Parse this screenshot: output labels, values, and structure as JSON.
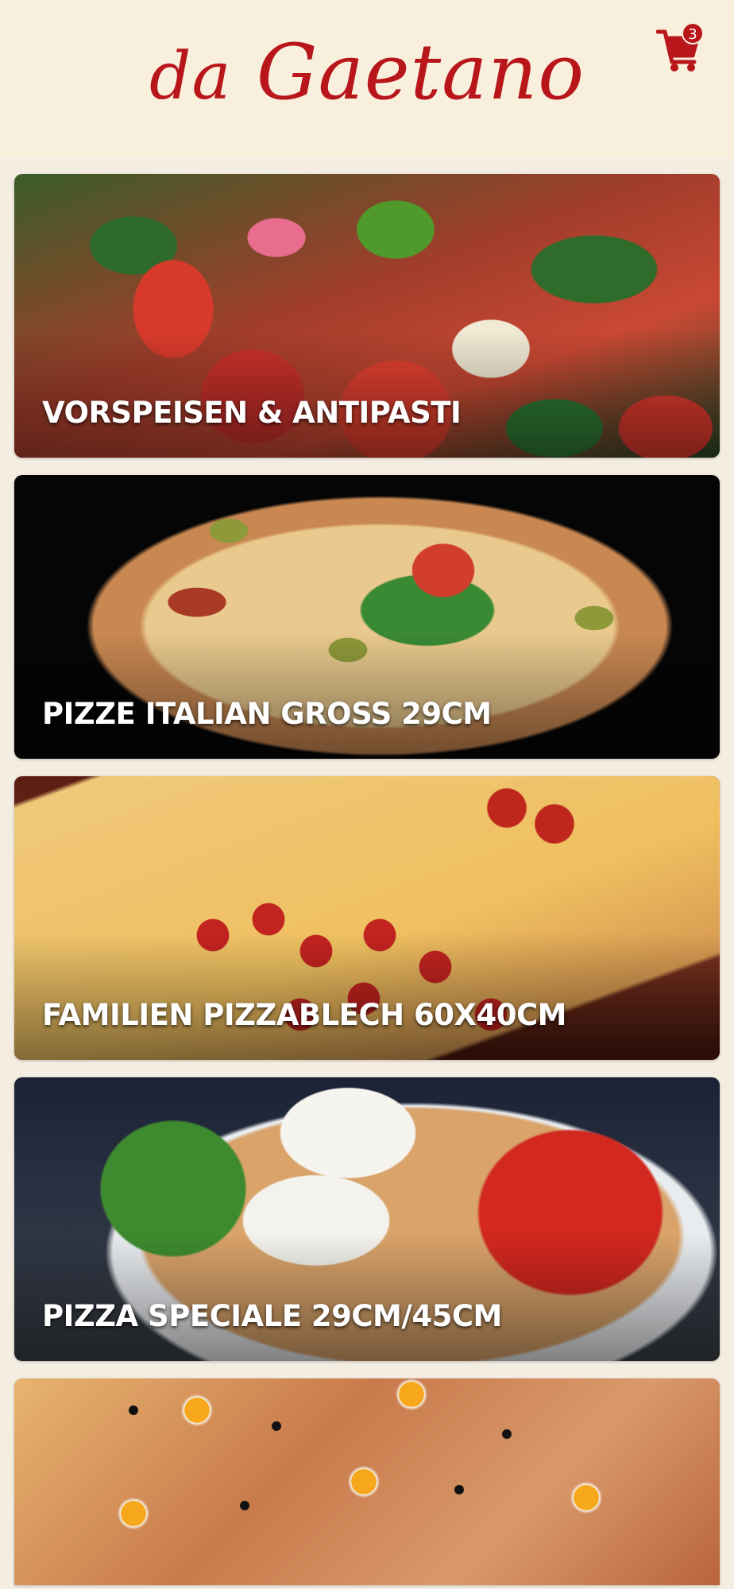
{
  "header": {
    "logo_prefix": "da",
    "logo_name": "Gaetano",
    "cart_count": "3",
    "cart_icon": "shopping-cart-icon",
    "brand_color": "#b8161b",
    "background_color": "#f8efdd"
  },
  "categories": [
    {
      "label": "VORSPEISEN & ANTIPASTI"
    },
    {
      "label": "PIZZE ITALIAN GROSS 29CM"
    },
    {
      "label": "FAMILIEN PIZZABLECH 60X40CM"
    },
    {
      "label": "PIZZA SPECIALE 29CM/45CM"
    },
    {
      "label": ""
    }
  ]
}
